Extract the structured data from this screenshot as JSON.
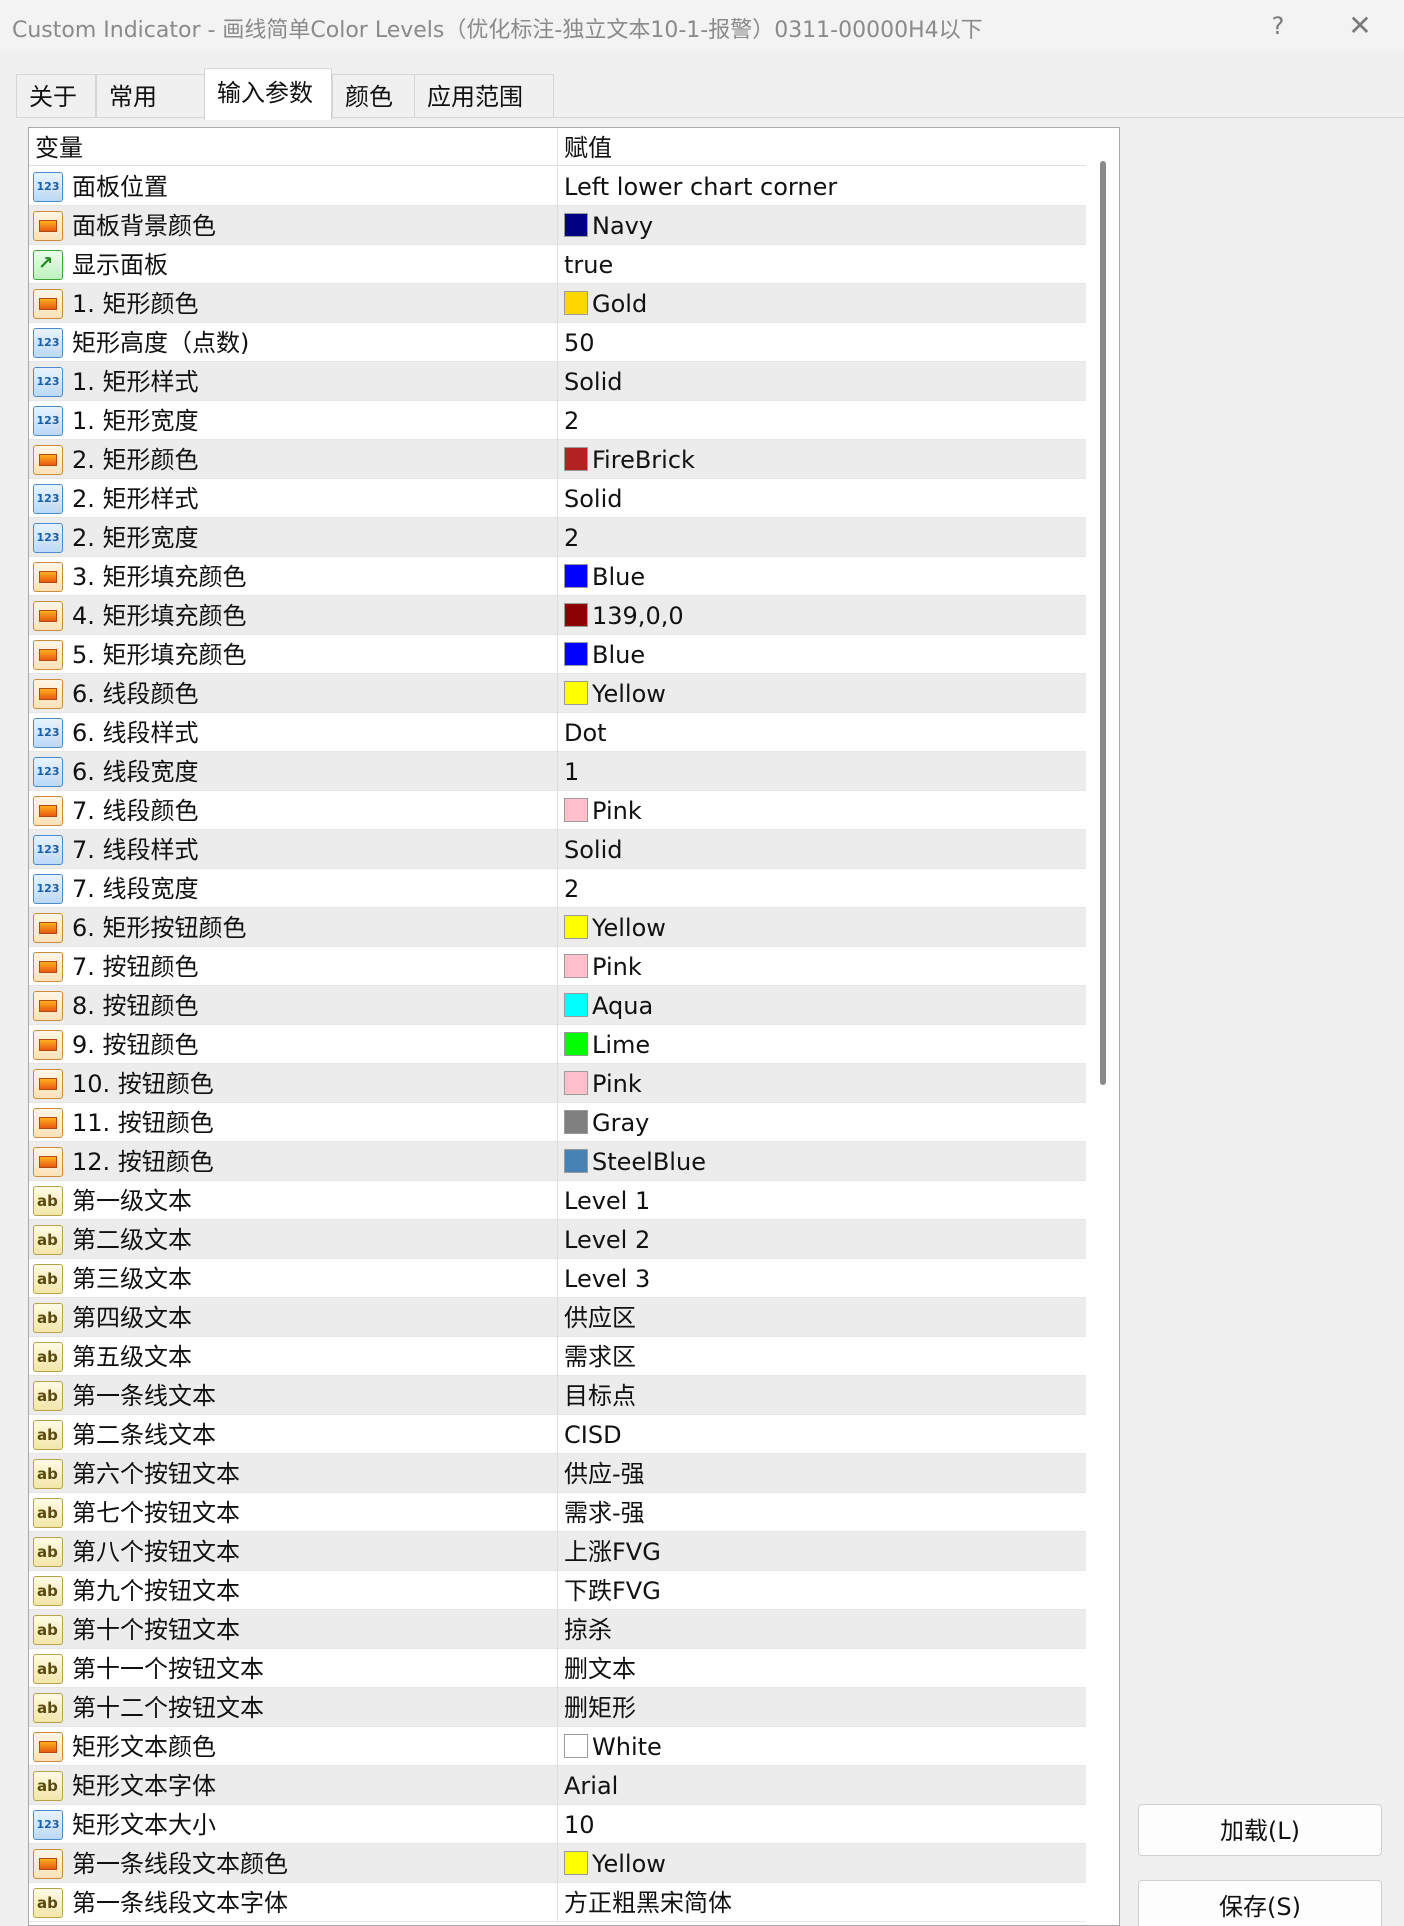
{
  "window": {
    "title": "Custom Indicator - 画线简单Color Levels（优化标注-独立文本10-1-报警）0311-00000H4以下",
    "help_label": "?",
    "close_label": "✕"
  },
  "tabs": [
    {
      "label": "关于"
    },
    {
      "label": "常用"
    },
    {
      "label": "输入参数"
    },
    {
      "label": "颜色"
    },
    {
      "label": "应用范围"
    }
  ],
  "grid": {
    "header": {
      "name": "变量",
      "value": "赋值"
    },
    "rows": [
      {
        "type": "num",
        "name": "面板位置",
        "value": "Left lower chart corner"
      },
      {
        "type": "color",
        "name": "面板背景颜色",
        "value": "Navy",
        "swatch": "#000080"
      },
      {
        "type": "bool",
        "name": "显示面板",
        "value": "true"
      },
      {
        "type": "color",
        "name": "1. 矩形颜色",
        "value": "Gold",
        "swatch": "#FFD700"
      },
      {
        "type": "num",
        "name": "矩形高度（点数)",
        "value": "50"
      },
      {
        "type": "num",
        "name": "1. 矩形样式",
        "value": "Solid"
      },
      {
        "type": "num",
        "name": "1. 矩形宽度",
        "value": "2"
      },
      {
        "type": "color",
        "name": "2. 矩形颜色",
        "value": "FireBrick",
        "swatch": "#B22222"
      },
      {
        "type": "num",
        "name": "2. 矩形样式",
        "value": "Solid"
      },
      {
        "type": "num",
        "name": "2. 矩形宽度",
        "value": "2"
      },
      {
        "type": "color",
        "name": "3. 矩形填充颜色",
        "value": "Blue",
        "swatch": "#0000FF"
      },
      {
        "type": "color",
        "name": "4. 矩形填充颜色",
        "value": "139,0,0",
        "swatch": "#8B0000"
      },
      {
        "type": "color",
        "name": "5. 矩形填充颜色",
        "value": "Blue",
        "swatch": "#0000FF"
      },
      {
        "type": "color",
        "name": "6. 线段颜色",
        "value": "Yellow",
        "swatch": "#FFFF00"
      },
      {
        "type": "num",
        "name": "6. 线段样式",
        "value": "Dot"
      },
      {
        "type": "num",
        "name": "6. 线段宽度",
        "value": "1"
      },
      {
        "type": "color",
        "name": "7. 线段颜色",
        "value": "Pink",
        "swatch": "#FFC0CB"
      },
      {
        "type": "num",
        "name": "7. 线段样式",
        "value": "Solid"
      },
      {
        "type": "num",
        "name": "7. 线段宽度",
        "value": "2"
      },
      {
        "type": "color",
        "name": "6. 矩形按钮颜色",
        "value": "Yellow",
        "swatch": "#FFFF00"
      },
      {
        "type": "color",
        "name": "7. 按钮颜色",
        "value": "Pink",
        "swatch": "#FFC0CB"
      },
      {
        "type": "color",
        "name": "8. 按钮颜色",
        "value": "Aqua",
        "swatch": "#00FFFF"
      },
      {
        "type": "color",
        "name": "9. 按钮颜色",
        "value": "Lime",
        "swatch": "#00FF00"
      },
      {
        "type": "color",
        "name": "10. 按钮颜色",
        "value": "Pink",
        "swatch": "#FFC0CB"
      },
      {
        "type": "color",
        "name": "11. 按钮颜色",
        "value": "Gray",
        "swatch": "#808080"
      },
      {
        "type": "color",
        "name": "12. 按钮颜色",
        "value": "SteelBlue",
        "swatch": "#4682B4"
      },
      {
        "type": "str",
        "name": "第一级文本",
        "value": "Level 1"
      },
      {
        "type": "str",
        "name": "第二级文本",
        "value": "Level 2"
      },
      {
        "type": "str",
        "name": "第三级文本",
        "value": "Level 3"
      },
      {
        "type": "str",
        "name": "第四级文本",
        "value": "供应区"
      },
      {
        "type": "str",
        "name": "第五级文本",
        "value": "需求区"
      },
      {
        "type": "str",
        "name": "第一条线文本",
        "value": "目标点"
      },
      {
        "type": "str",
        "name": "第二条线文本",
        "value": "CISD"
      },
      {
        "type": "str",
        "name": "第六个按钮文本",
        "value": "供应-强"
      },
      {
        "type": "str",
        "name": "第七个按钮文本",
        "value": "需求-强"
      },
      {
        "type": "str",
        "name": "第八个按钮文本",
        "value": "上涨FVG"
      },
      {
        "type": "str",
        "name": "第九个按钮文本",
        "value": "下跌FVG"
      },
      {
        "type": "str",
        "name": "第十个按钮文本",
        "value": "掠杀"
      },
      {
        "type": "str",
        "name": "第十一个按钮文本",
        "value": "删文本"
      },
      {
        "type": "str",
        "name": "第十二个按钮文本",
        "value": "删矩形"
      },
      {
        "type": "color",
        "name": "矩形文本颜色",
        "value": "White",
        "swatch": "#FFFFFF"
      },
      {
        "type": "str",
        "name": "矩形文本字体",
        "value": "Arial"
      },
      {
        "type": "num",
        "name": "矩形文本大小",
        "value": "10"
      },
      {
        "type": "color",
        "name": "第一条线段文本颜色",
        "value": "Yellow",
        "swatch": "#FFFF00"
      },
      {
        "type": "str",
        "name": "第一条线段文本字体",
        "value": "方正粗黑宋简体"
      }
    ]
  },
  "buttons": {
    "load": "加载(L)",
    "save": "保存(S)"
  },
  "icon_glyphs": {
    "num": "123",
    "color": "",
    "bool": "↗",
    "str": "ab"
  }
}
